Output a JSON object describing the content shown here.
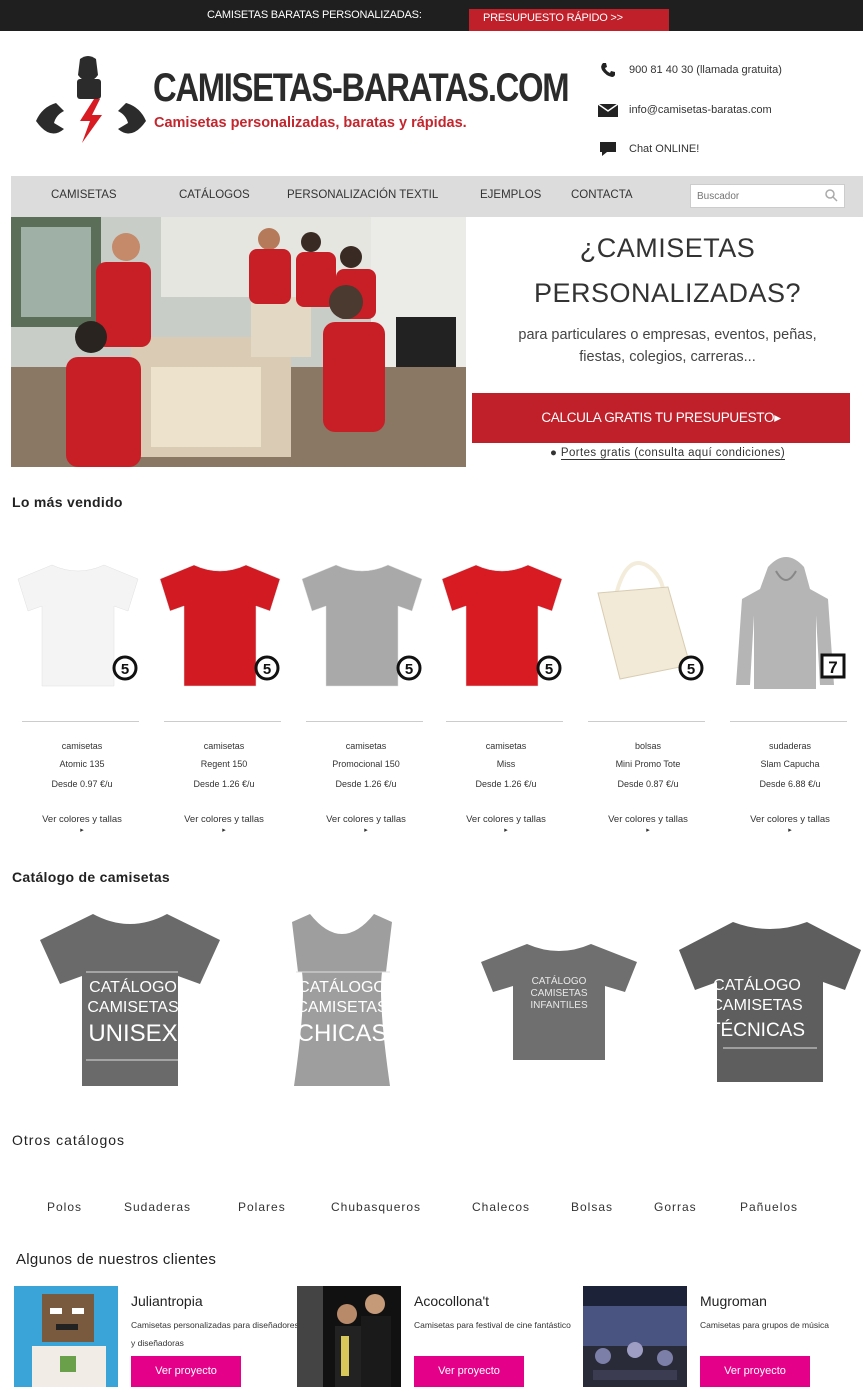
{
  "topbar": {
    "message": "CAMISETAS BARATAS PERSONALIZADAS:",
    "cta": "PRESUPUESTO RÁPIDO >>"
  },
  "brand": {
    "title": "CAMISETAS-BARATAS.COM",
    "tagline": "Camisetas personalizadas, baratas y rápidas.",
    "accent": "#c4262e"
  },
  "contact": {
    "phone": "900 81 40 30 (llamada gratuita)",
    "email": "info@camisetas-baratas.com",
    "chat": "Chat ONLINE!"
  },
  "nav": {
    "items": [
      "CAMISETAS",
      "CATÁLOGOS",
      "PERSONALIZACIÓN TEXTIL",
      "EJEMPLOS",
      "CONTACTA"
    ],
    "search_placeholder": "Buscador"
  },
  "hero": {
    "title_line1": "¿CAMISETAS",
    "title_line2": "PERSONALIZADAS?",
    "subtitle_line1": "para particulares o empresas, eventos, peñas,",
    "subtitle_line2": "fiestas, colegios, carreras...",
    "button": "CALCULA GRATIS TU PRESUPUESTO▸",
    "shipping_bullet": "●",
    "shipping": "Portes gratis (consulta aquí condiciones)"
  },
  "bestsellers": {
    "title": "Lo más vendido",
    "more_label": "Ver colores y tallas",
    "more_arrow": "▸",
    "products": [
      {
        "category": "camisetas",
        "name": "Atomic 135",
        "price": "Desde 0.97 €/u",
        "badge": "5",
        "color": "#f4f4f4"
      },
      {
        "category": "camisetas",
        "name": "Regent 150",
        "price": "Desde 1.26 €/u",
        "badge": "5",
        "color": "#d11a22"
      },
      {
        "category": "camisetas",
        "name": "Promocional 150",
        "price": "Desde 1.26 €/u",
        "badge": "5",
        "color": "#a9a9a9"
      },
      {
        "category": "camisetas",
        "name": "Miss",
        "price": "Desde 1.26 €/u",
        "badge": "5",
        "color": "#d81a22"
      },
      {
        "category": "bolsas",
        "name": "Mini Promo Tote",
        "price": "Desde 0.87 €/u",
        "badge": "5",
        "color": "#f2ead6"
      },
      {
        "category": "sudaderas",
        "name": "Slam Capucha",
        "price": "Desde 6.88 €/u",
        "badge": "7",
        "color": "#b5b5b5"
      }
    ]
  },
  "catalogs": {
    "title": "Catálogo de camisetas",
    "items": [
      {
        "line1": "CATÁLOGO",
        "line2": "CAMISETAS",
        "line3": "UNISEX",
        "color": "#6a6a6a"
      },
      {
        "line1": "CATÁLOGO",
        "line2": "CAMISETAS",
        "line3": "CHICAS",
        "color": "#9e9e9e"
      },
      {
        "line1": "CATÁLOGO",
        "line2": "CAMISETAS",
        "line3": "INFANTILES",
        "color": "#6f6f6f"
      },
      {
        "line1": "CATÁLOGO",
        "line2": "CAMISETAS",
        "line3": "TÉCNICAS",
        "color": "#5e5e5e"
      }
    ]
  },
  "other_catalogs": {
    "title": "Otros catálogos",
    "items": [
      "Polos",
      "Sudaderas",
      "Polares",
      "Chubasqueros",
      "Chalecos",
      "Bolsas",
      "Gorras",
      "Pañuelos"
    ]
  },
  "clients": {
    "title": "Algunos de nuestros clientes",
    "button": "Ver proyecto",
    "items": [
      {
        "name": "Juliantropia",
        "desc": "Camisetas personalizadas para diseñadores y diseñadoras"
      },
      {
        "name": "Acocollona't",
        "desc": "Camisetas para festival de cine fantástico"
      },
      {
        "name": "Mugroman",
        "desc": "Camisetas para grupos de música"
      }
    ]
  }
}
